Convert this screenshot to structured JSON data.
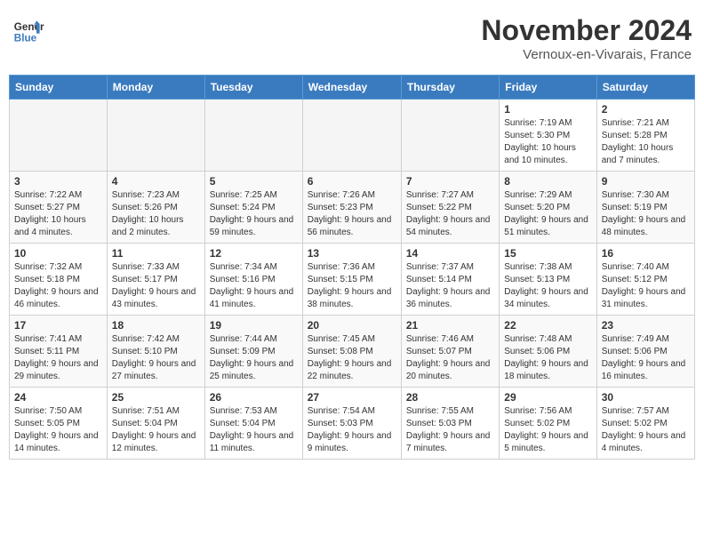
{
  "header": {
    "logo_line1": "General",
    "logo_line2": "Blue",
    "month": "November 2024",
    "location": "Vernoux-en-Vivarais, France"
  },
  "days_of_week": [
    "Sunday",
    "Monday",
    "Tuesday",
    "Wednesday",
    "Thursday",
    "Friday",
    "Saturday"
  ],
  "weeks": [
    [
      {
        "day": "",
        "info": ""
      },
      {
        "day": "",
        "info": ""
      },
      {
        "day": "",
        "info": ""
      },
      {
        "day": "",
        "info": ""
      },
      {
        "day": "",
        "info": ""
      },
      {
        "day": "1",
        "info": "Sunrise: 7:19 AM\nSunset: 5:30 PM\nDaylight: 10 hours and 10 minutes."
      },
      {
        "day": "2",
        "info": "Sunrise: 7:21 AM\nSunset: 5:28 PM\nDaylight: 10 hours and 7 minutes."
      }
    ],
    [
      {
        "day": "3",
        "info": "Sunrise: 7:22 AM\nSunset: 5:27 PM\nDaylight: 10 hours and 4 minutes."
      },
      {
        "day": "4",
        "info": "Sunrise: 7:23 AM\nSunset: 5:26 PM\nDaylight: 10 hours and 2 minutes."
      },
      {
        "day": "5",
        "info": "Sunrise: 7:25 AM\nSunset: 5:24 PM\nDaylight: 9 hours and 59 minutes."
      },
      {
        "day": "6",
        "info": "Sunrise: 7:26 AM\nSunset: 5:23 PM\nDaylight: 9 hours and 56 minutes."
      },
      {
        "day": "7",
        "info": "Sunrise: 7:27 AM\nSunset: 5:22 PM\nDaylight: 9 hours and 54 minutes."
      },
      {
        "day": "8",
        "info": "Sunrise: 7:29 AM\nSunset: 5:20 PM\nDaylight: 9 hours and 51 minutes."
      },
      {
        "day": "9",
        "info": "Sunrise: 7:30 AM\nSunset: 5:19 PM\nDaylight: 9 hours and 48 minutes."
      }
    ],
    [
      {
        "day": "10",
        "info": "Sunrise: 7:32 AM\nSunset: 5:18 PM\nDaylight: 9 hours and 46 minutes."
      },
      {
        "day": "11",
        "info": "Sunrise: 7:33 AM\nSunset: 5:17 PM\nDaylight: 9 hours and 43 minutes."
      },
      {
        "day": "12",
        "info": "Sunrise: 7:34 AM\nSunset: 5:16 PM\nDaylight: 9 hours and 41 minutes."
      },
      {
        "day": "13",
        "info": "Sunrise: 7:36 AM\nSunset: 5:15 PM\nDaylight: 9 hours and 38 minutes."
      },
      {
        "day": "14",
        "info": "Sunrise: 7:37 AM\nSunset: 5:14 PM\nDaylight: 9 hours and 36 minutes."
      },
      {
        "day": "15",
        "info": "Sunrise: 7:38 AM\nSunset: 5:13 PM\nDaylight: 9 hours and 34 minutes."
      },
      {
        "day": "16",
        "info": "Sunrise: 7:40 AM\nSunset: 5:12 PM\nDaylight: 9 hours and 31 minutes."
      }
    ],
    [
      {
        "day": "17",
        "info": "Sunrise: 7:41 AM\nSunset: 5:11 PM\nDaylight: 9 hours and 29 minutes."
      },
      {
        "day": "18",
        "info": "Sunrise: 7:42 AM\nSunset: 5:10 PM\nDaylight: 9 hours and 27 minutes."
      },
      {
        "day": "19",
        "info": "Sunrise: 7:44 AM\nSunset: 5:09 PM\nDaylight: 9 hours and 25 minutes."
      },
      {
        "day": "20",
        "info": "Sunrise: 7:45 AM\nSunset: 5:08 PM\nDaylight: 9 hours and 22 minutes."
      },
      {
        "day": "21",
        "info": "Sunrise: 7:46 AM\nSunset: 5:07 PM\nDaylight: 9 hours and 20 minutes."
      },
      {
        "day": "22",
        "info": "Sunrise: 7:48 AM\nSunset: 5:06 PM\nDaylight: 9 hours and 18 minutes."
      },
      {
        "day": "23",
        "info": "Sunrise: 7:49 AM\nSunset: 5:06 PM\nDaylight: 9 hours and 16 minutes."
      }
    ],
    [
      {
        "day": "24",
        "info": "Sunrise: 7:50 AM\nSunset: 5:05 PM\nDaylight: 9 hours and 14 minutes."
      },
      {
        "day": "25",
        "info": "Sunrise: 7:51 AM\nSunset: 5:04 PM\nDaylight: 9 hours and 12 minutes."
      },
      {
        "day": "26",
        "info": "Sunrise: 7:53 AM\nSunset: 5:04 PM\nDaylight: 9 hours and 11 minutes."
      },
      {
        "day": "27",
        "info": "Sunrise: 7:54 AM\nSunset: 5:03 PM\nDaylight: 9 hours and 9 minutes."
      },
      {
        "day": "28",
        "info": "Sunrise: 7:55 AM\nSunset: 5:03 PM\nDaylight: 9 hours and 7 minutes."
      },
      {
        "day": "29",
        "info": "Sunrise: 7:56 AM\nSunset: 5:02 PM\nDaylight: 9 hours and 5 minutes."
      },
      {
        "day": "30",
        "info": "Sunrise: 7:57 AM\nSunset: 5:02 PM\nDaylight: 9 hours and 4 minutes."
      }
    ]
  ]
}
